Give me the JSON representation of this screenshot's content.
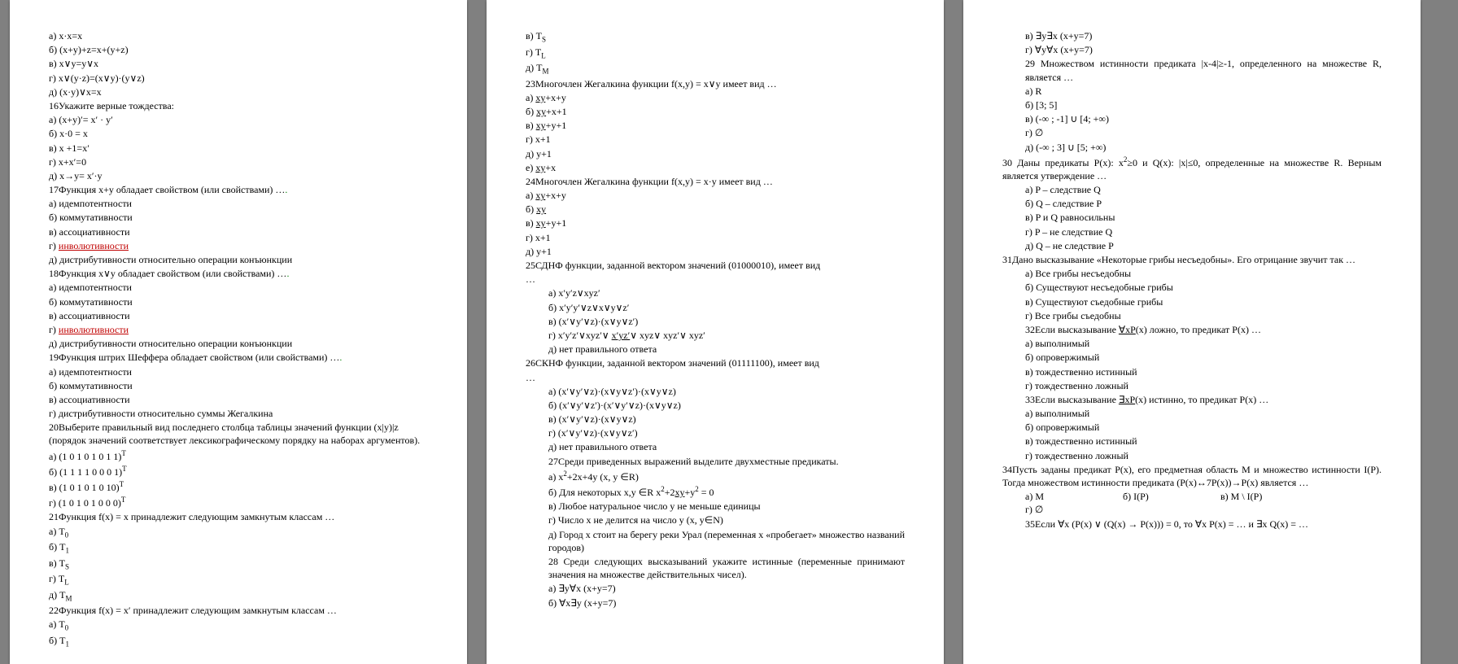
{
  "col1": [
    {
      "t": "а) x·x=x"
    },
    {
      "t": "б) (x+y)+z=x+(y+z)"
    },
    {
      "t": "в) x∨y=y∨x"
    },
    {
      "t": "г) x∨(y·z)=(x∨y)·(y∨z)"
    },
    {
      "t": "д) (x·y)∨x=x"
    },
    {
      "t": "16Укажите верные тождества:"
    },
    {
      "t": "а) (x+y)′= x′ · y′"
    },
    {
      "t": "б) x·0 = x"
    },
    {
      "t": "в) x +1=x′"
    },
    {
      "t": "г) x+x′=0"
    },
    {
      "t": "д) x→y= x′·y"
    },
    {
      "html": "17Функция x+y обладает свойством (или свойствами) …<span class='green'>.</span>"
    },
    {
      "t": "а) идемпотентности"
    },
    {
      "t": "б) коммутативности"
    },
    {
      "t": "в) ассоциативности"
    },
    {
      "html": "г) <span class='red-u'>инволютивности</span>"
    },
    {
      "t": "д) дистрибутивности относительно операции конъюнкции"
    },
    {
      "html": "18Функция x∨y обладает свойством (или свойствами) …<span class='green'>.</span>"
    },
    {
      "t": "а) идемпотентности"
    },
    {
      "t": "б) коммутативности"
    },
    {
      "t": "в) ассоциативности"
    },
    {
      "html": "г) <span class='red-u'>инволютивности</span>"
    },
    {
      "t": "д) дистрибутивности относительно операции конъюнкции"
    },
    {
      "html": "19Функция штрих Шеффера обладает свойством (или свойствами) …<span class='green'>.</span>"
    },
    {
      "t": "а) идемпотентности"
    },
    {
      "t": "б) коммутативности"
    },
    {
      "t": "в) ассоциативности"
    },
    {
      "t": "г) дистрибутивности относительно суммы Жегалкина"
    },
    {
      "t": "20Выберите правильный вид последнего столбца таблицы значений функции (x|y)|z (порядок значений соответствует лексикографическому порядку на наборах аргументов)."
    },
    {
      "html": "а) (1 0 1 0 1 0 1 1)<span class='sup'>T</span>"
    },
    {
      "html": "б) (1 1 1 1 0 0 0 1)<span class='sup'>T</span>"
    },
    {
      "html": "в) (1 0 1 0 1 0 10)<span class='sup'>T</span>"
    },
    {
      "html": "г) (1 0 1 0 1 0 0 0)<span class='sup'>T</span>"
    },
    {
      "t": "21Функция f(x) = x принадлежит следующим замкнутым классам …"
    },
    {
      "html": "а) T<span class='sub'>0</span>"
    },
    {
      "html": "б) T<span class='sub'>1</span>"
    },
    {
      "html": "в) T<span class='sub'>S</span>"
    },
    {
      "html": "г) T<span class='sub'>L</span>"
    },
    {
      "html": "д) T<span class='sub'>M</span>"
    },
    {
      "t": "22Функция f(x) = x′ принадлежит следующим замкнутым классам …"
    },
    {
      "html": "а) T<span class='sub'>0</span>"
    },
    {
      "html": "б) T<span class='sub'>1</span>"
    }
  ],
  "col2": [
    {
      "html": "в) T<span class='sub'>S</span>"
    },
    {
      "html": "г) T<span class='sub'>L</span>"
    },
    {
      "html": "д) T<span class='sub'>M</span>"
    },
    {
      "t": "23Многочлен Жегалкина функции f(x,y) = x∨y имеет вид …"
    },
    {
      "html": "а) <u>xy</u>+x+y"
    },
    {
      "html": "б) <u>xy</u>+x+1"
    },
    {
      "html": "в) <u>xy</u>+y+1"
    },
    {
      "t": "г) x+1"
    },
    {
      "t": "д) y+1"
    },
    {
      "html": "е) <u>xy</u>+x"
    },
    {
      "t": "24Многочлен Жегалкина функции f(x,y) = x·y имеет вид …"
    },
    {
      "html": "а) <u>xy</u>+x+y"
    },
    {
      "html": "б) <u>xy</u>"
    },
    {
      "html": "в) <u>xy</u>+y+1"
    },
    {
      "t": "г) x+1"
    },
    {
      "t": "д) y+1"
    },
    {
      "t": "25СДНФ функции, заданной вектором значений (01000010), имеет вид"
    },
    {
      "t": "…",
      "cls": ""
    },
    {
      "t": "а) x′y′z∨xyz′",
      "cls": "indent"
    },
    {
      "t": "б) x′y′y′∨z∨x∨y∨z′",
      "cls": "indent"
    },
    {
      "t": "в) (x′∨y′∨z)·(x∨y∨z′)",
      "cls": "indent"
    },
    {
      "html": "г) x′y′z′∨xyz′∨ <u>x′yz′</u>∨ xyz∨ xyz′∨ xyz′",
      "cls": "indent"
    },
    {
      "t": "д) нет правильного ответа",
      "cls": "indent"
    },
    {
      "t": "26СКНФ функции, заданной вектором значений (01111100), имеет вид"
    },
    {
      "t": "…",
      "cls": ""
    },
    {
      "t": "а) (x′∨y′∨z)·(x∨y∨z′)·(x∨y∨z)",
      "cls": "indent"
    },
    {
      "t": "б) (x′∨y′∨z′)·(x′∨y′∨z)·(x∨y∨z)",
      "cls": "indent"
    },
    {
      "t": "в) (x′∨y′∨z)·(x∨y∨z)",
      "cls": "indent"
    },
    {
      "t": "г) (x′∨y′∨z)·(x∨y∨z′)",
      "cls": "indent"
    },
    {
      "t": "д) нет правильного ответа",
      "cls": "indent"
    },
    {
      "t": "27Среди приведенных выражений выделите двухместные предикаты.",
      "cls": "indent"
    },
    {
      "html": "а) x<span class='sup'>2</span>+2x+4y (x, y ∈R)",
      "cls": "indent"
    },
    {
      "html": "б) Для некоторых  x,y ∈R x<span class='sup'>2</span>+2<u>xy</u>+y<span class='sup'>2</span> = 0",
      "cls": "indent"
    },
    {
      "t": "в) Любое натуральное число y не меньше единицы",
      "cls": "indent"
    },
    {
      "t": "г) Число x не делится на число y (x, y∈N)",
      "cls": "indent"
    },
    {
      "t": "д) Город x стоит на берегу реки Урал (переменная x «пробегает» множество названий городов)",
      "cls": "indent just"
    },
    {
      "t": "28 Среди следующих высказываний укажите истинные (переменные принимают значения на множестве действительных чисел).",
      "cls": "indent just"
    },
    {
      "t": "а) ∃y∀x (x+y=7)",
      "cls": "indent"
    },
    {
      "t": "б) ∀x∃y (x+y=7)",
      "cls": "indent"
    }
  ],
  "col3": [
    {
      "t": "в) ∃y∃x (x+y=7)",
      "cls": "indent"
    },
    {
      "t": "г) ∀y∀x (x+y=7)",
      "cls": "indent"
    },
    {
      "t": " "
    },
    {
      "t": "29 Множеством истинности предиката |x-4|≥-1, определенного на множестве R, является …",
      "cls": "indent just"
    },
    {
      "t": "а) R",
      "cls": "indent"
    },
    {
      "t": "б) [3; 5]",
      "cls": "indent"
    },
    {
      "t": "в) (-∞ ; -1] ∪ [4; +∞)",
      "cls": "indent"
    },
    {
      "t": "г) ∅",
      "cls": "indent"
    },
    {
      "t": "д) (-∞ ; 3] ∪ [5; +∞)",
      "cls": "indent"
    },
    {
      "html": "30 Даны предикаты P(x): x<span class='sup'>2</span>≥0 и Q(x): |x|≤0, определенные на множестве R. Верным является утверждение …",
      "cls": "just"
    },
    {
      "t": "а) P – следствие Q",
      "cls": "indent"
    },
    {
      "t": "б) Q – следствие P",
      "cls": "indent"
    },
    {
      "t": "в) P и Q равносильны",
      "cls": "indent"
    },
    {
      "t": "г) P – не следствие Q",
      "cls": "indent"
    },
    {
      "t": "д) Q – не следствие P",
      "cls": "indent"
    },
    {
      "t": "31Дано высказывание «Некоторые грибы несъедобны». Его отрицание звучит так …",
      "cls": "just"
    },
    {
      "t": "а) Все грибы несъедобны",
      "cls": "indent"
    },
    {
      "t": "б) Существуют несъедобные грибы",
      "cls": "indent"
    },
    {
      "t": "в) Существуют съедобные грибы",
      "cls": "indent"
    },
    {
      "t": "г)  Все грибы съедобны",
      "cls": "indent"
    },
    {
      "html": "32Если высказывание <u>∀xP</u>(x) ложно, то предикат P(x) …",
      "cls": "indent"
    },
    {
      "t": "а) выполнимый",
      "cls": "indent"
    },
    {
      "t": "б) опровержимый",
      "cls": "indent"
    },
    {
      "t": "в) тождественно истинный",
      "cls": "indent"
    },
    {
      "t": "г) тождественно ложный",
      "cls": "indent"
    },
    {
      "html": "33Если высказывание <u>∃xP</u>(x) истинно, то предикат P(x) …",
      "cls": "indent"
    },
    {
      "t": "а) выполнимый",
      "cls": "indent"
    },
    {
      "t": "б) опровержимый",
      "cls": "indent"
    },
    {
      "t": "в) тождественно истинный",
      "cls": "indent"
    },
    {
      "t": "г) тождественно ложный",
      "cls": "indent"
    },
    {
      "t": "34Пусть заданы предикат P(x), его предметная область M и множество истинности I(P). Тогда множеством истинности предиката (P(x)↔7P(x))→P(x) является …",
      "cls": "just"
    },
    {
      "html": "<span class='inline-opt'>а) M</span><span class='inline-opt'>б) I(P)</span><span class='inline-opt'>в) M \\ I(P)</span><span class='inline-opt'>г) ∅</span>",
      "cls": "indent"
    },
    {
      "t": "35Если ∀x (P(x) ∨ (Q(x) → P(x))) = 0, то ∀x P(x) = … и ∃x Q(x) = …",
      "cls": "indent"
    }
  ]
}
